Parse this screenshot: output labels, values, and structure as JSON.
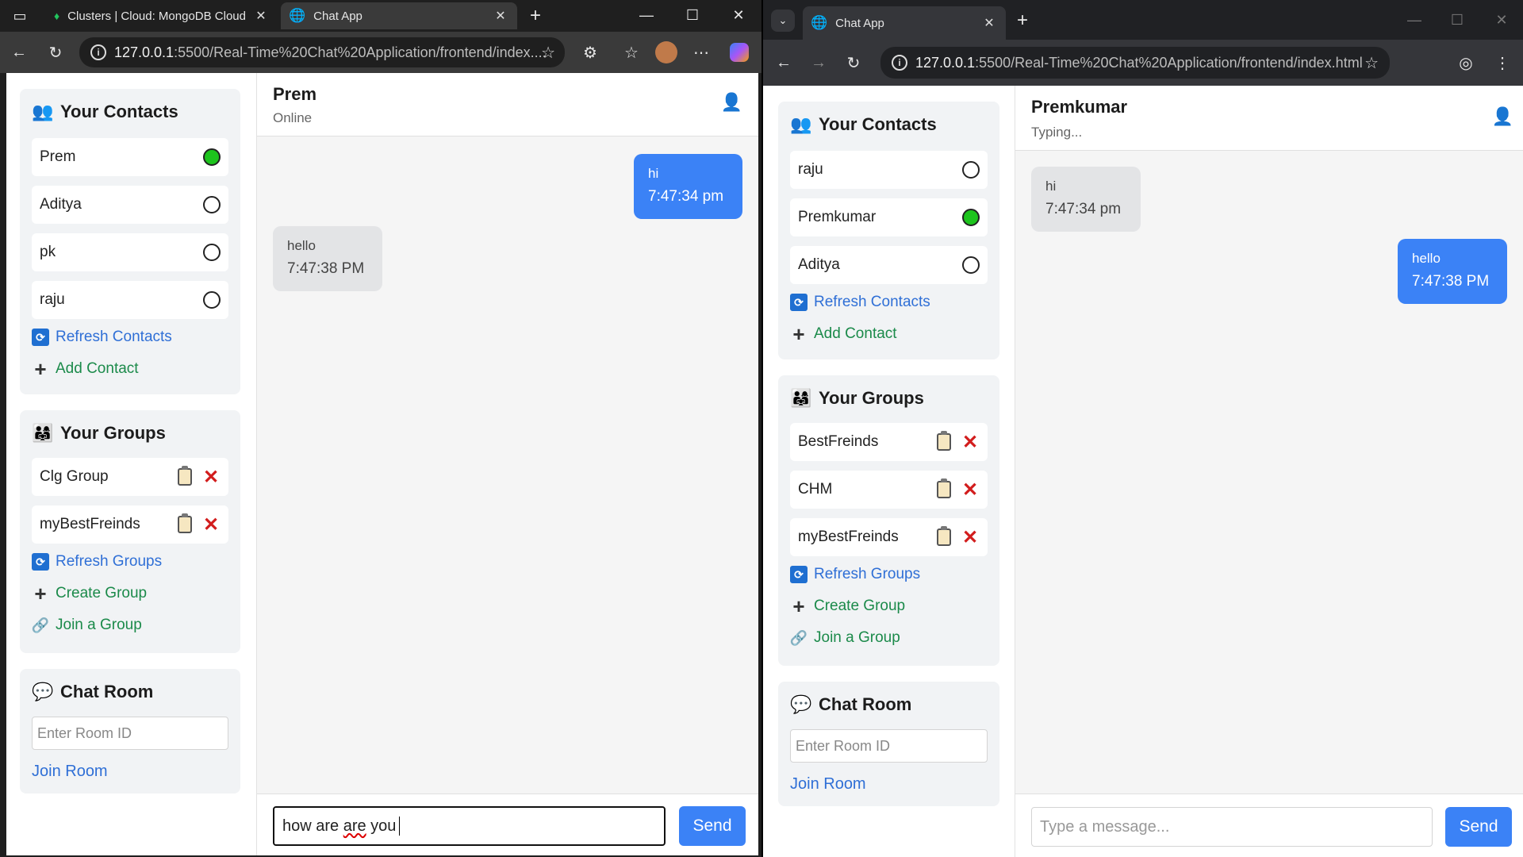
{
  "left": {
    "tabs": [
      {
        "title": "Clusters | Cloud: MongoDB Cloud",
        "icon": "mongodb-leaf-icon"
      },
      {
        "title": "Chat App",
        "icon": "globe-icon"
      }
    ],
    "url_host": "127.0.0.1",
    "url_path": ":5500/Real-Time%20Chat%20Application/frontend/index....",
    "contacts": {
      "title": "Your Contacts",
      "items": [
        {
          "name": "Prem",
          "status": "online"
        },
        {
          "name": "Aditya",
          "status": "offline"
        },
        {
          "name": "pk",
          "status": "offline"
        },
        {
          "name": "raju",
          "status": "offline"
        }
      ],
      "refresh": "Refresh Contacts",
      "add": "Add Contact"
    },
    "groups": {
      "title": "Your Groups",
      "items": [
        "Clg Group",
        "myBestFreinds"
      ],
      "refresh": "Refresh Groups",
      "create": "Create Group",
      "join": "Join a Group"
    },
    "room": {
      "title": "Chat Room",
      "placeholder": "Enter Room ID",
      "join": "Join Room"
    },
    "chat": {
      "name": "Prem",
      "status": "Online",
      "messages": [
        {
          "dir": "out",
          "text": "hi",
          "time": "7:47:34 pm"
        },
        {
          "dir": "in",
          "text": "hello",
          "time": "7:47:38 PM"
        }
      ],
      "input_before": "how are ",
      "input_misspelled": "are",
      "input_after": " you",
      "send": "Send"
    }
  },
  "right": {
    "tab_title": "Chat App",
    "url_host": "127.0.0.1",
    "url_path": ":5500/Real-Time%20Chat%20Application/frontend/index.html",
    "contacts": {
      "title": "Your Contacts",
      "items": [
        {
          "name": "raju",
          "status": "offline"
        },
        {
          "name": "Premkumar",
          "status": "online"
        },
        {
          "name": "Aditya",
          "status": "offline"
        }
      ],
      "refresh": "Refresh Contacts",
      "add": "Add Contact"
    },
    "groups": {
      "title": "Your Groups",
      "items": [
        "BestFreinds",
        "CHM",
        "myBestFreinds"
      ],
      "refresh": "Refresh Groups",
      "create": "Create Group",
      "join": "Join a Group"
    },
    "room": {
      "title": "Chat Room",
      "placeholder": "Enter Room ID",
      "join": "Join Room"
    },
    "chat": {
      "name": "Premkumar",
      "status": "Typing...",
      "messages": [
        {
          "dir": "in",
          "text": "hi",
          "time": "7:47:34 pm"
        },
        {
          "dir": "out",
          "text": "hello",
          "time": "7:47:38 PM"
        }
      ],
      "placeholder": "Type a message...",
      "send": "Send"
    }
  },
  "colors": {
    "accent": "#3b82f6",
    "online": "#1dc41d",
    "link_blue": "#2f6fd6",
    "link_green": "#1b8a4a",
    "danger": "#d21d1d"
  }
}
